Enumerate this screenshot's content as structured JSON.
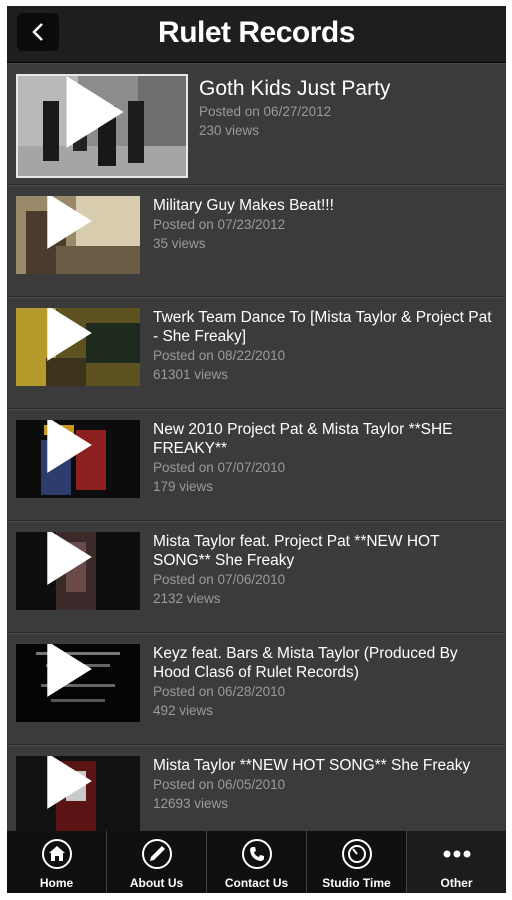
{
  "header": {
    "title": "Rulet Records"
  },
  "videos": [
    {
      "title": "Goth Kids Just Party",
      "posted": "Posted on 06/27/2012",
      "views": "230 views"
    },
    {
      "title": "Military Guy Makes Beat!!!",
      "posted": "Posted on 07/23/2012",
      "views": "35 views"
    },
    {
      "title": "Twerk Team Dance To [Mista Taylor & Project Pat - She Freaky]",
      "posted": "Posted on 08/22/2010",
      "views": "61301 views"
    },
    {
      "title": "New 2010 Project Pat & Mista Taylor **SHE FREAKY**",
      "posted": "Posted on 07/07/2010",
      "views": "179 views"
    },
    {
      "title": "Mista Taylor feat. Project Pat **NEW HOT SONG** She Freaky",
      "posted": "Posted on 07/06/2010",
      "views": "2132 views"
    },
    {
      "title": "Keyz feat. Bars & Mista Taylor (Produced By Hood Clas6 of Rulet Records)",
      "posted": "Posted on 06/28/2010",
      "views": "492 views"
    },
    {
      "title": "Mista Taylor **NEW HOT SONG** She Freaky",
      "posted": "Posted on 06/05/2010",
      "views": "12693 views"
    }
  ],
  "tabs": [
    {
      "label": "Home",
      "icon": "home-icon"
    },
    {
      "label": "About Us",
      "icon": "pen-icon"
    },
    {
      "label": "Contact Us",
      "icon": "phone-icon"
    },
    {
      "label": "Studio Time",
      "icon": "timer-icon"
    },
    {
      "label": "Other",
      "icon": "more-icon"
    }
  ]
}
